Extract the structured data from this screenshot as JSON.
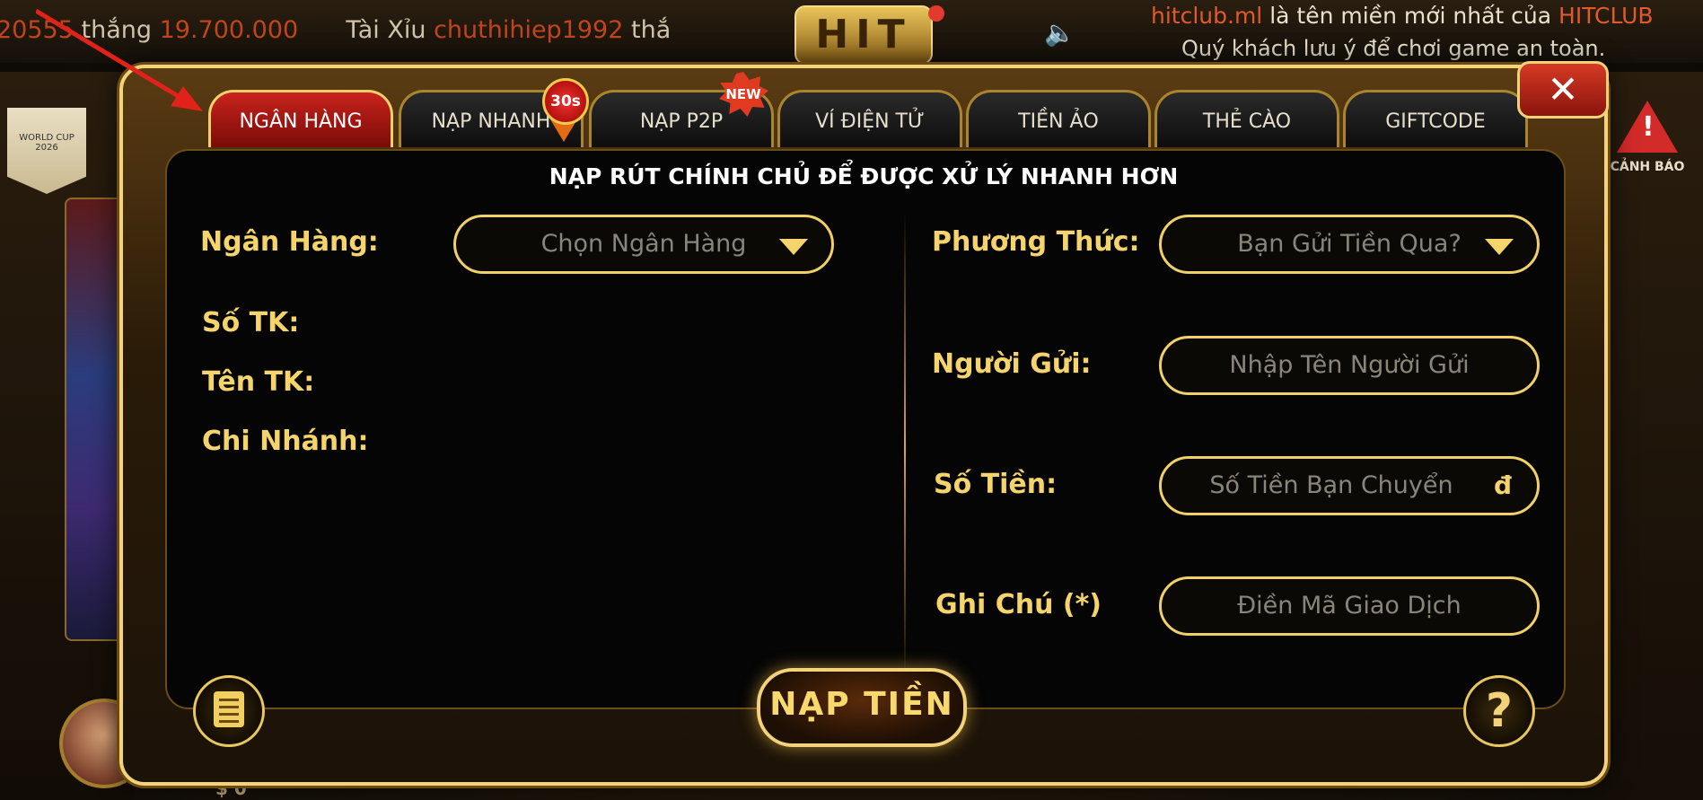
{
  "ticker": {
    "prefix_num": "20555",
    "won_word": "thắng",
    "amount": "19.700.000",
    "game": "Tài Xỉu",
    "player": "chuthihiep1992",
    "won_word2": "thắ"
  },
  "logo_text": "HIT",
  "notice": {
    "domain": "hitclub.ml",
    "middle": " là tên miền mới nhất của ",
    "brand": "HITCLUB",
    "line2": "Quý khách lưu ý để chơi game an toàn."
  },
  "background": {
    "flag_text": "WORLD CUP 2026",
    "coin_text": "$ 0",
    "warning_label": "CẢNH BÁO"
  },
  "tabs": [
    {
      "label": "NGÂN HÀNG",
      "active": true
    },
    {
      "label": "NẠP NHANH",
      "active": false
    },
    {
      "label": "NẠP P2P",
      "active": false
    },
    {
      "label": "VÍ ĐIỆN TỬ",
      "active": false
    },
    {
      "label": "TIỀN ẢO",
      "active": false
    },
    {
      "label": "THẺ CÀO",
      "active": false
    },
    {
      "label": "GIFTCODE",
      "active": false
    }
  ],
  "badges": {
    "timer": "30s",
    "new": "NEW"
  },
  "close_label": "✕",
  "headline": "NẠP RÚT CHÍNH CHỦ ĐỂ ĐƯỢC XỬ LÝ NHANH HƠN",
  "left": {
    "bank_label": "Ngân Hàng:",
    "bank_placeholder": "Chọn Ngân Hàng",
    "account_no_label": "Số TK:",
    "account_name_label": "Tên TK:",
    "branch_label": "Chi Nhánh:"
  },
  "right": {
    "method_label": "Phương Thức:",
    "method_placeholder": "Bạn Gửi Tiền Qua?",
    "sender_label": "Người Gửi:",
    "sender_placeholder": "Nhập Tên Người Gửi",
    "amount_label": "Số Tiền:",
    "amount_placeholder": "Số Tiền Bạn Chuyển",
    "currency_symbol": "đ",
    "note_label": "Ghi Chú (*)",
    "note_placeholder": "Điền Mã Giao Dịch"
  },
  "buttons": {
    "submit": "NẠP TIỀN",
    "help": "?"
  },
  "colors": {
    "accent_gold": "#f5d46b",
    "active_tab_red": "#c9231c",
    "arrow_red": "#e0221b"
  }
}
